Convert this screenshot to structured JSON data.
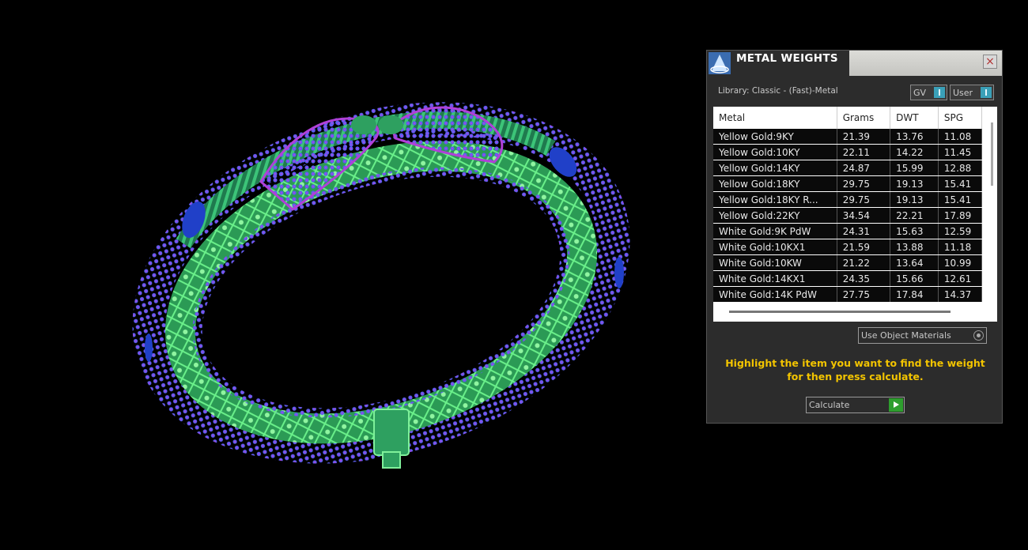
{
  "panel": {
    "title": "METAL WEIGHTS",
    "close_label": "×",
    "library_label": "Library: Classic - (Fast)-Metal",
    "toggles": [
      {
        "label": "GV"
      },
      {
        "label": "User"
      }
    ],
    "table": {
      "columns": [
        "Metal",
        "Grams",
        "DWT",
        "SPG"
      ],
      "rows": [
        [
          "Yellow Gold:9KY",
          "21.39",
          "13.76",
          "11.08"
        ],
        [
          "Yellow Gold:10KY",
          "22.11",
          "14.22",
          "11.45"
        ],
        [
          "Yellow Gold:14KY",
          "24.87",
          "15.99",
          "12.88"
        ],
        [
          "Yellow Gold:18KY",
          "29.75",
          "19.13",
          "15.41"
        ],
        [
          "Yellow Gold:18KY R...",
          "29.75",
          "19.13",
          "15.41"
        ],
        [
          "Yellow Gold:22KY",
          "34.54",
          "22.21",
          "17.89"
        ],
        [
          "White Gold:9K PdW",
          "24.31",
          "15.63",
          "12.59"
        ],
        [
          "White Gold:10KX1",
          "21.59",
          "13.88",
          "11.18"
        ],
        [
          "White Gold:10KW",
          "21.22",
          "13.64",
          "10.99"
        ],
        [
          "White Gold:14KX1",
          "24.35",
          "15.66",
          "12.61"
        ],
        [
          "White Gold:14K PdW",
          "27.75",
          "17.84",
          "14.37"
        ]
      ]
    },
    "use_object_materials_label": "Use Object Materials",
    "instruction_line1": "Highlight the item you want to find the weight",
    "instruction_line2": "for then press calculate.",
    "calculate_label": "Calculate"
  },
  "colors": {
    "instruction": "#f2c400",
    "accent_teal": "#3aa0b8",
    "go_green": "#2e9e2e",
    "bangle_green": "#34c46a",
    "bangle_blue": "#5560e8",
    "bangle_purple": "#b040d8"
  }
}
